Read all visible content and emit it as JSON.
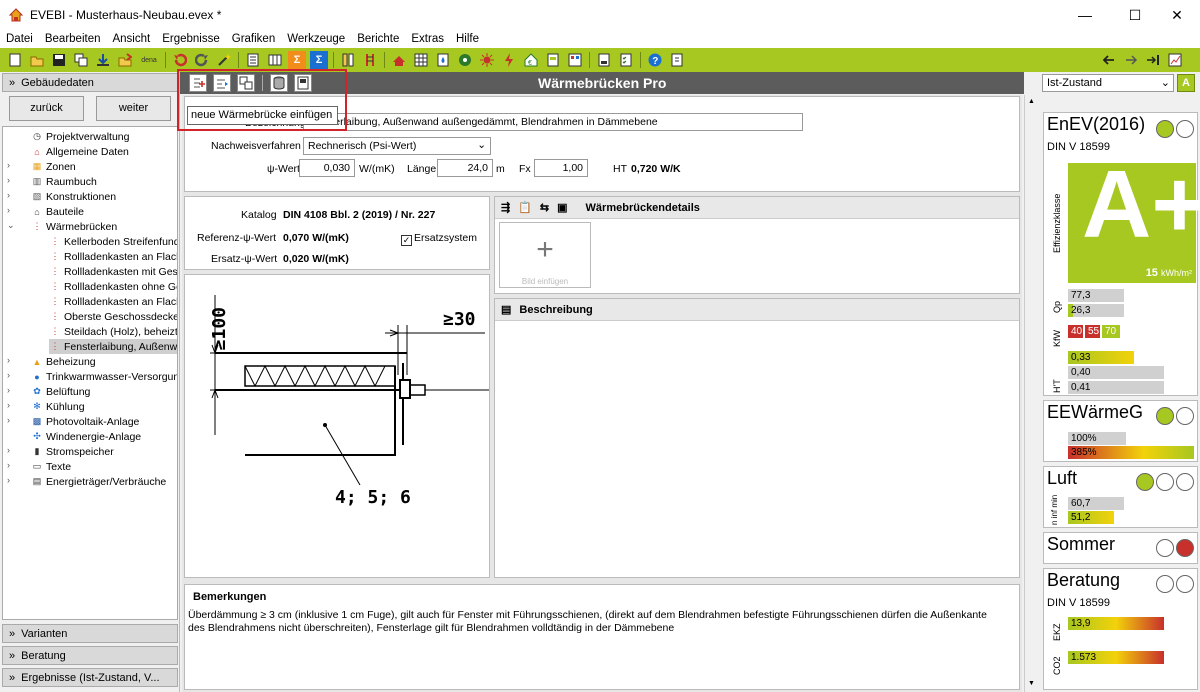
{
  "window": {
    "title": "EVEBI - Musterhaus-Neubau.evex *",
    "min": "—",
    "max": "☐",
    "close": "✕"
  },
  "menu": [
    "Datei",
    "Bearbeiten",
    "Ansicht",
    "Ergebnisse",
    "Grafiken",
    "Werkzeuge",
    "Berichte",
    "Extras",
    "Hilfe"
  ],
  "toolbar": {
    "dena": "dena"
  },
  "left": {
    "header": "Gebäudedaten",
    "back": "zurück",
    "forward": "weiter",
    "tree": [
      {
        "label": "Projektverwaltung",
        "icon": "clock-icon",
        "level": 0,
        "exp": ""
      },
      {
        "label": "Allgemeine Daten",
        "icon": "house-icon",
        "level": 0,
        "exp": ""
      },
      {
        "label": "Zonen",
        "icon": "zone-icon",
        "level": 0,
        "exp": ">"
      },
      {
        "label": "Raumbuch",
        "icon": "book-icon",
        "level": 0,
        "exp": ">"
      },
      {
        "label": "Konstruktionen",
        "icon": "construction-icon",
        "level": 0,
        "exp": ">"
      },
      {
        "label": "Bauteile",
        "icon": "component-icon",
        "level": 0,
        "exp": ">"
      },
      {
        "label": "Wärmebrücken",
        "icon": "thermal-bridge-icon",
        "level": 0,
        "exp": "v"
      },
      {
        "label": "Kellerboden Streifenfunda",
        "icon": "thermal-bridge-icon",
        "level": 1,
        "exp": ""
      },
      {
        "label": "Rollladenkasten an Flachc",
        "icon": "thermal-bridge-icon",
        "level": 1,
        "exp": ""
      },
      {
        "label": "Rollladenkasten mit Gesch",
        "icon": "thermal-bridge-icon",
        "level": 1,
        "exp": ""
      },
      {
        "label": "Rollladenkasten ohne Ges",
        "icon": "thermal-bridge-icon",
        "level": 1,
        "exp": ""
      },
      {
        "label": "Rollladenkasten an Flachc",
        "icon": "thermal-bridge-icon",
        "level": 1,
        "exp": ""
      },
      {
        "label": "Oberste Geschossdecke,",
        "icon": "thermal-bridge-icon",
        "level": 1,
        "exp": ""
      },
      {
        "label": "Steildach (Holz), beheizte",
        "icon": "thermal-bridge-icon",
        "level": 1,
        "exp": ""
      },
      {
        "label": "Fensterlaibung, Außenwa",
        "icon": "thermal-bridge-icon",
        "level": 1,
        "exp": "",
        "selected": true
      },
      {
        "label": "Beheizung",
        "icon": "heating-icon",
        "level": 0,
        "exp": ">"
      },
      {
        "label": "Trinkwarmwasser-Versorgung",
        "icon": "water-drop-icon",
        "level": 0,
        "exp": ">"
      },
      {
        "label": "Belüftung",
        "icon": "fan-icon",
        "level": 0,
        "exp": ">"
      },
      {
        "label": "Kühlung",
        "icon": "snowflake-icon",
        "level": 0,
        "exp": ">"
      },
      {
        "label": "Photovoltaik-Anlage",
        "icon": "pv-icon",
        "level": 0,
        "exp": ">"
      },
      {
        "label": "Windenergie-Anlage",
        "icon": "wind-icon",
        "level": 0,
        "exp": ""
      },
      {
        "label": "Stromspeicher",
        "icon": "battery-icon",
        "level": 0,
        "exp": ">"
      },
      {
        "label": "Texte",
        "icon": "text-icon",
        "level": 0,
        "exp": ">"
      },
      {
        "label": "Energieträger/Verbräuche",
        "icon": "energy-icon",
        "level": 0,
        "exp": ">"
      }
    ],
    "footers": [
      "Varianten",
      "Beratung",
      "Ergebnisse (Ist-Zustand, V..."
    ]
  },
  "header": {
    "title": "Wärmebrücken Pro"
  },
  "tooltip": "neue Wärmebrücke einfügen",
  "form": {
    "bezeichnung_label": "Bezeichnung",
    "bezeichnung": "Fensterlaibung, Außenwand außengedämmt, Blendrahmen in Dämmebene",
    "nachweis_label": "Nachweisverfahren",
    "nachweis": "Rechnerisch (Psi-Wert)",
    "psi_label": "ψ-Wert",
    "psi": "0,030",
    "psi_unit": "W/(mK)",
    "laenge_label": "Länge",
    "laenge": "24,0",
    "laenge_unit": "m",
    "fx_label": "Fx",
    "fx": "1,00",
    "ht_label": "HT",
    "ht": "0,720 W/K"
  },
  "catalog": {
    "katalog_label": "Katalog",
    "katalog": "DIN 4108 Bbl. 2 (2019) / Nr. 227",
    "ref_label": "Referenz-ψ-Wert",
    "ref": "0,070 W/(mK)",
    "ersatz_label": "Ersatz-ψ-Wert",
    "ersatz": "0,020 W/(mK)",
    "ersatzsystem": "Ersatzsystem"
  },
  "drawing": {
    "dim1": "≥100",
    "dim2": "≥30",
    "label": "4; 5; 6"
  },
  "details": {
    "title": "Wärmebrückendetails",
    "add": "+",
    "add_caption": "Bild einfügen"
  },
  "beschreibung": {
    "title": "Beschreibung"
  },
  "bemerkungen": {
    "title": "Bemerkungen",
    "text": "Überdämmung ≥ 3 cm (inklusive 1 cm Fuge), gilt auch für Fenster mit Führungsschienen, (direkt auf dem Blendrahmen befestigte Führungsschienen dürfen die Außenkante des Blendrahmens nicht überschreiten), Fensterlage gilt für Blendrahmen volldtändig in der Dämmebene"
  },
  "right": {
    "zustand": "Ist-Zustand",
    "enev": {
      "title": "EnEV(2016)",
      "norm": "DIN V 18599",
      "klasse_label": "Effizienzklasse",
      "klasse": "A+",
      "kwh": "15",
      "kwh_unit": "kWh/m²",
      "qp_label": "Qp",
      "qp": [
        "77,3",
        "26,3"
      ],
      "kw_label": "KfW",
      "kw": [
        "40",
        "55",
        "70"
      ],
      "ht_label": "H'T",
      "ht": [
        "0,33",
        "0,40",
        "0,41"
      ]
    },
    "ee": {
      "title": "EEWärmeG",
      "v1": "100%",
      "v2": "385%"
    },
    "luft": {
      "title": "Luft",
      "label": "n inf min",
      "v1": "60,7",
      "v2": "51,2"
    },
    "sommer": {
      "title": "Sommer"
    },
    "beratung": {
      "title": "Beratung",
      "norm": "DIN V 18599",
      "ekz_label": "EKZ",
      "ekz": "13,9",
      "co2_label": "CO2",
      "co2": "1.573"
    },
    "colors": {
      "green": "#a7c721",
      "red": "#c8302c",
      "yellow": "#f2d20a"
    }
  }
}
